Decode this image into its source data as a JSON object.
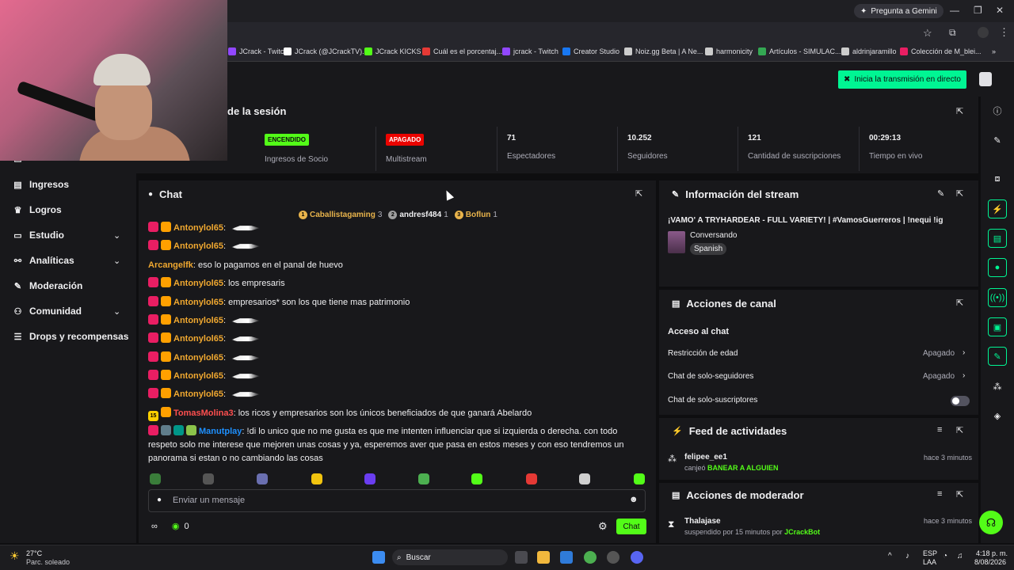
{
  "browser": {
    "gemini_label": "Pregunta a Gemini",
    "bookmarks": [
      {
        "label": "JCrack - Twitch",
        "color": "#9147ff"
      },
      {
        "label": "JCrack (@JCrackTV)...",
        "color": "#ffffff"
      },
      {
        "label": "JCrack KICKS",
        "color": "#53fc18"
      },
      {
        "label": "Cuál es el porcentaj...",
        "color": "#e53935"
      },
      {
        "label": "jcrack - Twitch",
        "color": "#9147ff"
      },
      {
        "label": "Creator Studio",
        "color": "#1877f2"
      },
      {
        "label": "Noiz.gg Beta | A Ne...",
        "color": "#cccccc"
      },
      {
        "label": "harmonicity",
        "color": "#cccccc"
      },
      {
        "label": "Artículos - SIMULAC...",
        "color": "#34a853"
      },
      {
        "label": "aldrinjaramillo",
        "color": "#cccccc"
      },
      {
        "label": "Colección de M_blei...",
        "color": "#e91e63"
      }
    ]
  },
  "app": {
    "golive_label": "Inicia la transmisión en directo"
  },
  "sidebar": {
    "partial_item": "Publicidad",
    "items": [
      {
        "label": "Ingresos",
        "icon": "wallet-icon",
        "chevron": false
      },
      {
        "label": "Logros",
        "icon": "trophy-icon",
        "chevron": false
      },
      {
        "label": "Estudio",
        "icon": "studio-icon",
        "chevron": true
      },
      {
        "label": "Analíticas",
        "icon": "analytics-icon",
        "chevron": true
      },
      {
        "label": "Moderación",
        "icon": "wrench-icon",
        "chevron": false
      },
      {
        "label": "Comunidad",
        "icon": "community-icon",
        "chevron": true
      },
      {
        "label": "Drops y recompensas",
        "icon": "drops-icon",
        "chevron": false
      }
    ]
  },
  "session": {
    "title": "de la sesión",
    "stats": [
      {
        "value": "ENCENDIDO",
        "label": "Ingresos de Socio",
        "pill": "#53fc18"
      },
      {
        "value": "APAGADO",
        "label": "Multistream",
        "pill": "#eb0400"
      },
      {
        "value": "71",
        "label": "Espectadores"
      },
      {
        "value": "10.252",
        "label": "Seguidores"
      },
      {
        "value": "121",
        "label": "Cantidad de suscripciones"
      },
      {
        "value": "00:29:13",
        "label": "Tiempo en vivo"
      }
    ]
  },
  "chat": {
    "title": "Chat",
    "leaderboard": [
      {
        "rank": "1",
        "name": "Caballistagaming",
        "count": "3",
        "color": "#e8b34b"
      },
      {
        "rank": "2",
        "name": "andresf484",
        "count": "1",
        "color": "#efeff1"
      },
      {
        "rank": "3",
        "name": "Boflun",
        "count": "1",
        "color": "#e8b34b"
      }
    ],
    "messages": [
      {
        "user": "Antonylol65",
        "color": "#f0a830",
        "text": "",
        "emote": true
      },
      {
        "user": "Antonylol65",
        "color": "#f0a830",
        "text": "",
        "emote": true
      },
      {
        "user": "Arcangelfk",
        "color": "#f0a830",
        "text": "eso lo pagamos en el panal de huevo",
        "emote": false
      },
      {
        "user": "Antonylol65",
        "color": "#f0a830",
        "text": "los empresaris",
        "emote": false
      },
      {
        "user": "Antonylol65",
        "color": "#f0a830",
        "text": "empresarios* son los que tiene mas patrimonio",
        "emote": false
      },
      {
        "user": "Antonylol65",
        "color": "#f0a830",
        "text": "",
        "emote": true
      },
      {
        "user": "Antonylol65",
        "color": "#f0a830",
        "text": "",
        "emote": true
      },
      {
        "user": "Antonylol65",
        "color": "#f0a830",
        "text": "",
        "emote": true
      },
      {
        "user": "Antonylol65",
        "color": "#f0a830",
        "text": "",
        "emote": true
      },
      {
        "user": "Antonylol65",
        "color": "#f0a830",
        "text": "",
        "emote": true
      },
      {
        "user": "TomasMolina3",
        "color": "#ff4f4f",
        "text": "los ricos y empresarios son los únicos beneficiados de que ganará Abelardo",
        "emote": false
      },
      {
        "user": "Manutplay",
        "color": "#1e90ff",
        "text": "!di lo unico que no me gusta es que me intenten influenciar que si izquierda o derecha. con todo",
        "emote": false
      }
    ],
    "wrap_lines": [
      "respeto solo me interese que mejoren unas cosas y ya, esperemos aver que pasa en estos meses y con eso tendremos un",
      "panorama si estan o no cambiando las cosas"
    ],
    "input_placeholder": "Enviar un mensaje",
    "points": "0",
    "send_label": "Chat"
  },
  "stream_info": {
    "title": "Información del stream",
    "stream_title": "¡VAMO' A TRYHARDEAR - FULL VARIETY! | #VamosGuerreros | !nequi !ig",
    "category": "Conversando",
    "tag": "Spanish"
  },
  "channel_actions": {
    "title": "Acciones de canal",
    "section": "Acceso al chat",
    "rows": [
      {
        "label": "Restricción de edad",
        "value": "Apagado"
      },
      {
        "label": "Chat de solo-seguidores",
        "value": "Apagado"
      },
      {
        "label": "Chat de solo-suscriptores",
        "value": ""
      }
    ]
  },
  "activity": {
    "title": "Feed de actividades",
    "user": "felipee_ee1",
    "verb": "canjeó",
    "item": "BANEAR A ALGUIEN",
    "time": "hace 3 minutos"
  },
  "mod_actions": {
    "title": "Acciones de moderador",
    "user": "Thalajase",
    "action": "suspendido por 15 minutos por",
    "by": "JCrackBot",
    "time": "hace 3 minutos"
  },
  "taskbar": {
    "weather_temp": "27°C",
    "weather_desc": "Parc. soleado",
    "search": "Buscar",
    "lang1": "ESP",
    "lang2": "LAA",
    "time": "4:18 p. m.",
    "date": "8/08/2026"
  }
}
